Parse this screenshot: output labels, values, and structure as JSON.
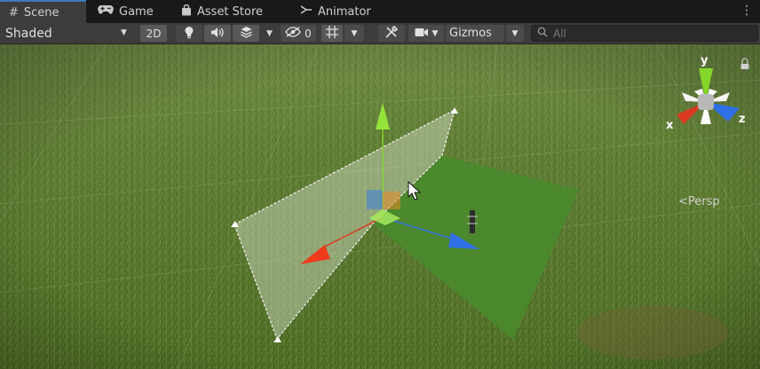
{
  "tabs": [
    {
      "label": "Scene",
      "icon": "grid-icon",
      "active": true
    },
    {
      "label": "Game",
      "icon": "gamepad-icon",
      "active": false
    },
    {
      "label": "Asset Store",
      "icon": "shopping-bag-icon",
      "active": false
    },
    {
      "label": "Animator",
      "icon": "animator-icon",
      "active": false
    }
  ],
  "toolbar": {
    "draw_mode": "Shaded",
    "mode_2d": "2D",
    "hidden_count": "0",
    "gizmos_label": "Gizmos",
    "search_placeholder": "All"
  },
  "scene": {
    "camera_mode": "Persp",
    "axis_labels": {
      "x": "x",
      "y": "y",
      "z": "z"
    }
  },
  "colors": {
    "accent": "#3a79bb",
    "axis_x": "#e0331a",
    "axis_y": "#85d62a",
    "axis_z": "#2f6fe6",
    "plane": "#4f8a2e"
  }
}
